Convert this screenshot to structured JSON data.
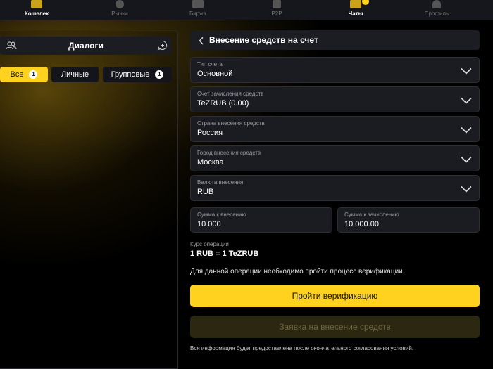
{
  "nav": {
    "items": [
      {
        "label": "Кошелек",
        "icon": "wallet-icon"
      },
      {
        "label": "Рынки",
        "icon": "coins-icon"
      },
      {
        "label": "Биржа",
        "icon": "chart-icon"
      },
      {
        "label": "P2P",
        "icon": "p2p-icon"
      },
      {
        "label": "Чаты",
        "icon": "chat-icon"
      },
      {
        "label": "Профиль",
        "icon": "profile-icon"
      }
    ],
    "active": "Чаты"
  },
  "dialogs": {
    "title": "Диалоги",
    "filters": [
      {
        "label": "Все",
        "count": "1"
      },
      {
        "label": "Личные",
        "count": ""
      },
      {
        "label": "Групповые",
        "count": "1"
      }
    ]
  },
  "form": {
    "title": "Внесение средств на счет",
    "fields": [
      {
        "label": "Тип счета",
        "value": "Основной"
      },
      {
        "label": "Счет зачисления средств",
        "value": "TeZRUB (0.00)"
      },
      {
        "label": "Страна внесения средств",
        "value": "Россия"
      },
      {
        "label": "Город внесения средств",
        "value": "Москва"
      },
      {
        "label": "Валюта внесения",
        "value": "RUB"
      }
    ],
    "deposit_amount": {
      "label": "Сумма к внесению",
      "value": "10 000"
    },
    "credit_amount": {
      "label": "Сумма к зачислению",
      "value": "10 000.00"
    },
    "rate_label": "Курс операции",
    "rate_value": "1 RUB = 1 TeZRUB",
    "verify_note": "Для данной операции необходимо пройти процесс верификации",
    "verify_button": "Пройти верификацию",
    "request_button": "Заявка на внесение средств",
    "footnote": "Вся информация будет предоставлена после окончательного согласования условий."
  },
  "colors": {
    "accent": "#ffd21f",
    "panel": "#1b1c21",
    "background": "#000000"
  }
}
